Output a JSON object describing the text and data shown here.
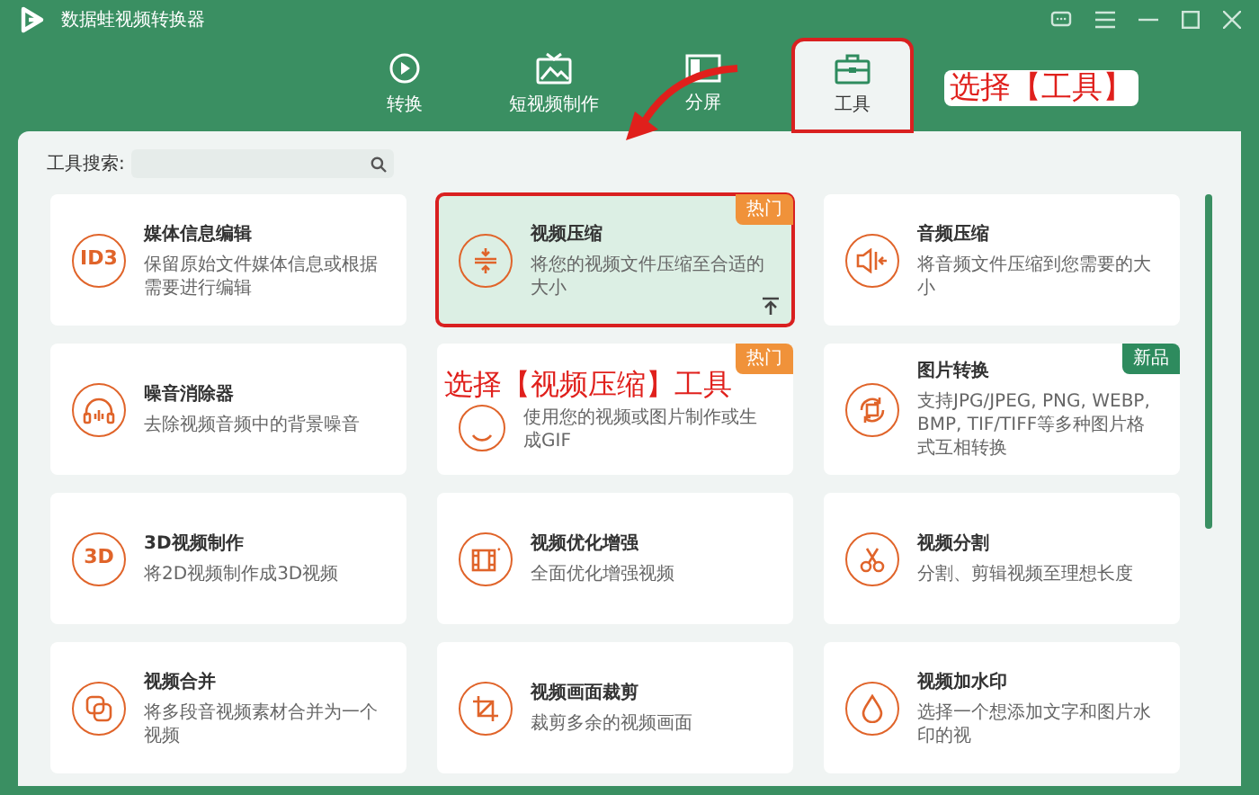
{
  "window": {
    "title": "数据蛙视频转换器"
  },
  "tabs": [
    {
      "label": "转换",
      "selected": false,
      "highlighted": false
    },
    {
      "label": "短视频制作",
      "selected": false,
      "highlighted": false
    },
    {
      "label": "分屏",
      "selected": false,
      "highlighted": false
    },
    {
      "label": "工具",
      "selected": true,
      "highlighted": true
    }
  ],
  "search": {
    "label": "工具搜索:"
  },
  "tools": [
    {
      "title": "媒体信息编辑",
      "description": "保留原始文件媒体信息或根据需要进行编辑",
      "icon_text": "ID3",
      "selected": false,
      "highlighted": false
    },
    {
      "title": "视频压缩",
      "description": "将您的视频文件压缩至合适的大小",
      "badge": {
        "text": "热门",
        "color": "#f0923a"
      },
      "selected": true,
      "highlighted": true,
      "pinned": true
    },
    {
      "title": "音频压缩",
      "description": "将音频文件压缩到您需要的大小",
      "selected": false,
      "highlighted": false
    },
    {
      "title": "噪音消除器",
      "description": "去除视频音频中的背景噪音",
      "selected": false,
      "highlighted": false
    },
    {
      "description": "使用您的视频或图片制作或生成GIF",
      "badge": {
        "text": "热门",
        "color": "#f0923a"
      },
      "selected": false,
      "highlighted": false
    },
    {
      "title": "图片转换",
      "description": "支持JPG/JPEG, PNG, WEBP, BMP, TIF/TIFF等多种图片格式互相转换",
      "badge": {
        "text": "新品",
        "color": "#2e8b5e"
      },
      "selected": false,
      "highlighted": false
    },
    {
      "title": "3D视频制作",
      "description": "将2D视频制作成3D视频",
      "icon_text": "3D",
      "selected": false,
      "highlighted": false
    },
    {
      "title": "视频优化增强",
      "description": "全面优化增强视频",
      "selected": false,
      "highlighted": false
    },
    {
      "title": "视频分割",
      "description": "分割、剪辑视频至理想长度",
      "selected": false,
      "highlighted": false
    },
    {
      "title": "视频合并",
      "description": "将多段音视频素材合并为一个视频",
      "selected": false,
      "highlighted": false
    },
    {
      "title": "视频画面裁剪",
      "description": "裁剪多余的视频画面",
      "selected": false,
      "highlighted": false
    },
    {
      "title": "视频加水印",
      "description": "选择一个想添加文字和图片水印的视",
      "selected": false,
      "highlighted": false
    }
  ],
  "annotations": [
    {
      "text": "选择【工具】"
    },
    {
      "text": "选择【视频压缩】工具"
    }
  ]
}
